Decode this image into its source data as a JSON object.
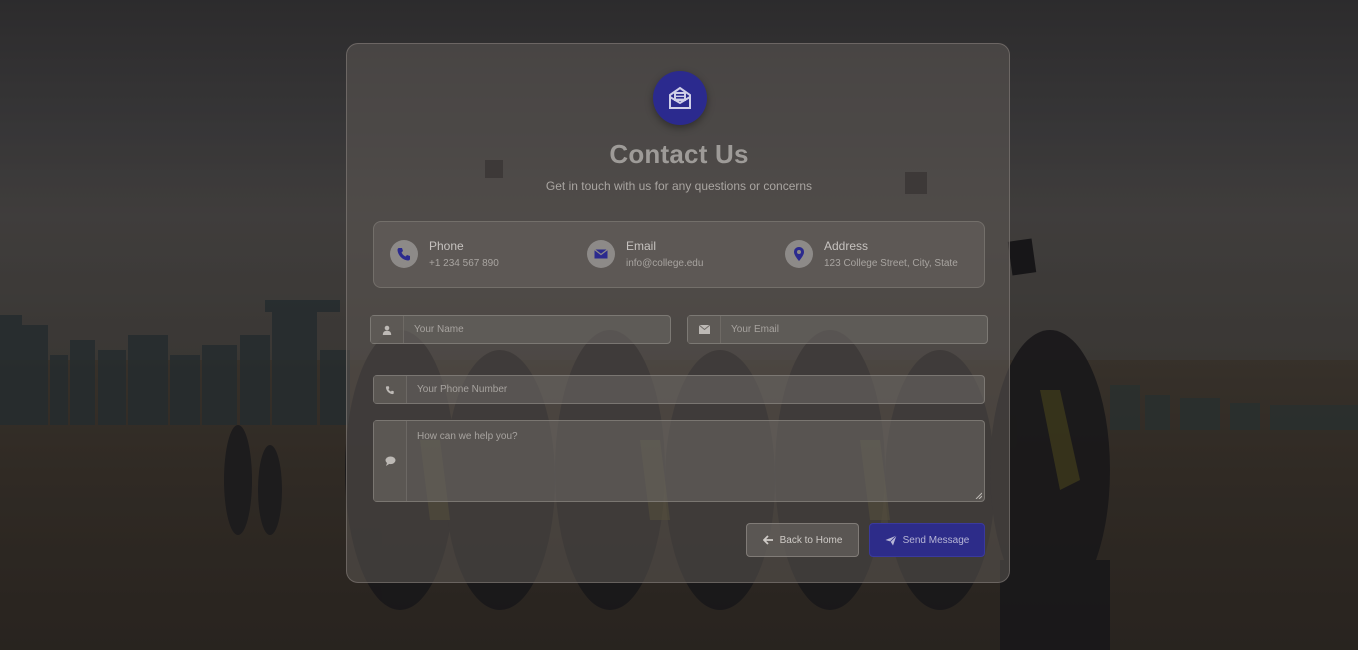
{
  "page": {
    "title": "Contact Us",
    "subtitle": "Get in touch with us for any questions or concerns"
  },
  "contact_info": [
    {
      "label": "Phone",
      "value": "+1 234 567 890",
      "icon": "phone-icon"
    },
    {
      "label": "Email",
      "value": "info@college.edu",
      "icon": "envelope-icon"
    },
    {
      "label": "Address",
      "value": "123 College Street, City, State",
      "icon": "map-pin-icon"
    }
  ],
  "form": {
    "name_placeholder": "Your Name",
    "email_placeholder": "Your Email",
    "phone_placeholder": "Your Phone Number",
    "message_placeholder": "How can we help you?"
  },
  "buttons": {
    "back_label": "Back to Home",
    "send_label": "Send Message"
  },
  "colors": {
    "accent": "#2d2c89",
    "logo_bg": "#2b2a8e"
  }
}
